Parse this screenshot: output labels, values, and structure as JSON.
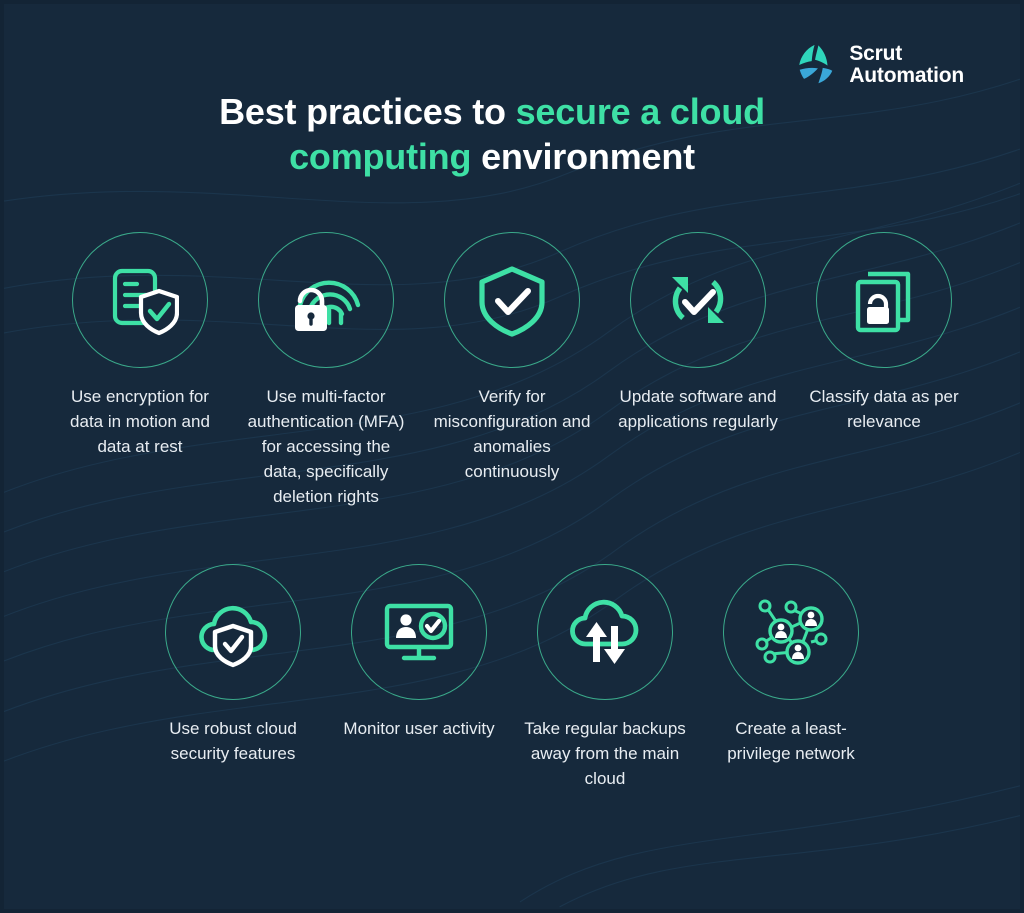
{
  "brand": {
    "name": "Scrut\nAutomation",
    "logo_icon": "scrut-trefoil-logo-icon",
    "accent_color": "#3ee0a5",
    "secondary_color": "#3aa7d8",
    "background_color": "#16293c",
    "text_color": "#e8edf2"
  },
  "title": {
    "part1": "Best practices to ",
    "accent1": "secure a cloud",
    "part2": " ",
    "accent2": "computing",
    "part3": " environment",
    "full": "Best practices to secure a cloud computing environment"
  },
  "practices": [
    {
      "index": "1",
      "icon": "document-shield-check-icon",
      "caption": "Use encryption for data in motion and data at rest"
    },
    {
      "index": "2",
      "icon": "fingerprint-padlock-icon",
      "caption": "Use multi-factor authentication (MFA) for accessing the data, specifically deletion rights"
    },
    {
      "index": "3",
      "icon": "shield-check-icon",
      "caption": "Verify for misconfiguration and anomalies continuously"
    },
    {
      "index": "4",
      "icon": "refresh-sync-check-icon",
      "caption": "Update software and applications regularly"
    },
    {
      "index": "5",
      "icon": "documents-padlock-icon",
      "caption": "Classify data as per relevance"
    },
    {
      "index": "6",
      "icon": "cloud-shield-check-icon",
      "caption": "Use robust cloud security features"
    },
    {
      "index": "7",
      "icon": "monitor-user-check-icon",
      "caption": "Monitor user activity"
    },
    {
      "index": "8",
      "icon": "cloud-upload-download-arrows-icon",
      "caption": "Take regular backups away from the main cloud"
    },
    {
      "index": "9",
      "icon": "user-network-nodes-icon",
      "caption": "Create a least-privilege network"
    }
  ]
}
